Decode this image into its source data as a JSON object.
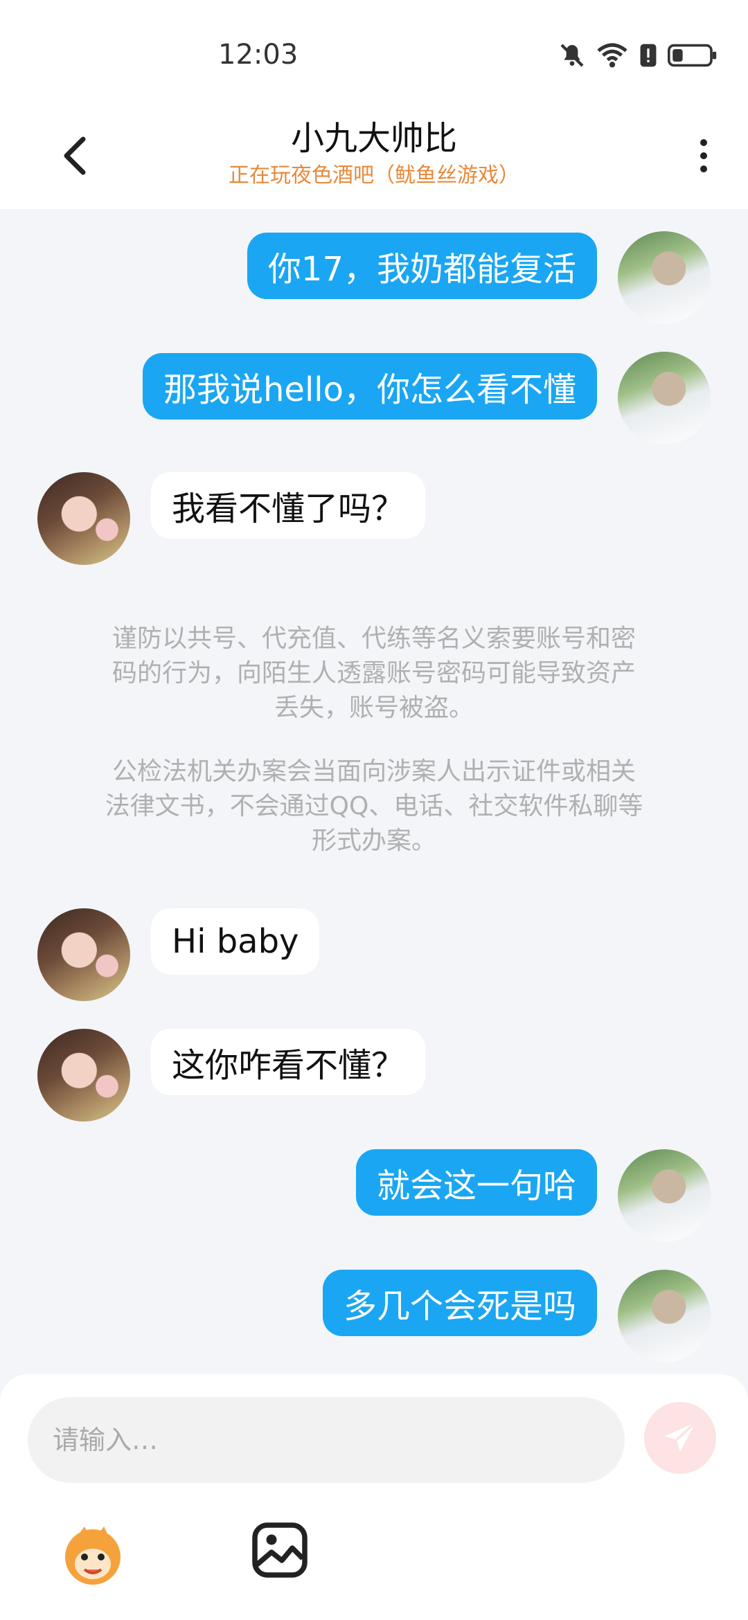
{
  "status_bar": {
    "time": "12:03",
    "icons": [
      "mute-icon",
      "wifi-icon",
      "alert-icon",
      "battery-icon"
    ]
  },
  "header": {
    "title": "小九大帅比",
    "subtitle": "正在玩夜色酒吧（鱿鱼丝游戏）",
    "back_icon": "chevron-left-icon",
    "more_icon": "more-vertical-icon"
  },
  "messages": [
    {
      "sender": "me",
      "text": "你17，我奶都能复活"
    },
    {
      "sender": "me",
      "text": "那我说hello，你怎么看不懂"
    },
    {
      "sender": "her",
      "text": "我看不懂了吗？"
    },
    {
      "sender": "her",
      "text": "Hi baby"
    },
    {
      "sender": "her",
      "text": "这你咋看不懂？"
    },
    {
      "sender": "me",
      "text": "就会这一句哈"
    },
    {
      "sender": "me",
      "text": "多几个会死是吗"
    }
  ],
  "notice": {
    "line_1": "谨防以共号、代充值、代练等名义索要账号和密",
    "line_2": "码的行为，向陌生人透露账号密码可能导致资产",
    "line_3": "丢失，账号被盗。",
    "line_4": "公检法机关办案会当面向涉案人出示证件或相关",
    "line_5": "法律文书，不会通过QQ、电话、社交软件私聊等",
    "line_6": "形式办案。"
  },
  "input": {
    "placeholder": "请输入…"
  },
  "colors": {
    "my_bubble": "#1aa6f2",
    "her_bubble": "#ffffff",
    "subtitle": "#e8893a",
    "send_button": "#fde3e3"
  }
}
